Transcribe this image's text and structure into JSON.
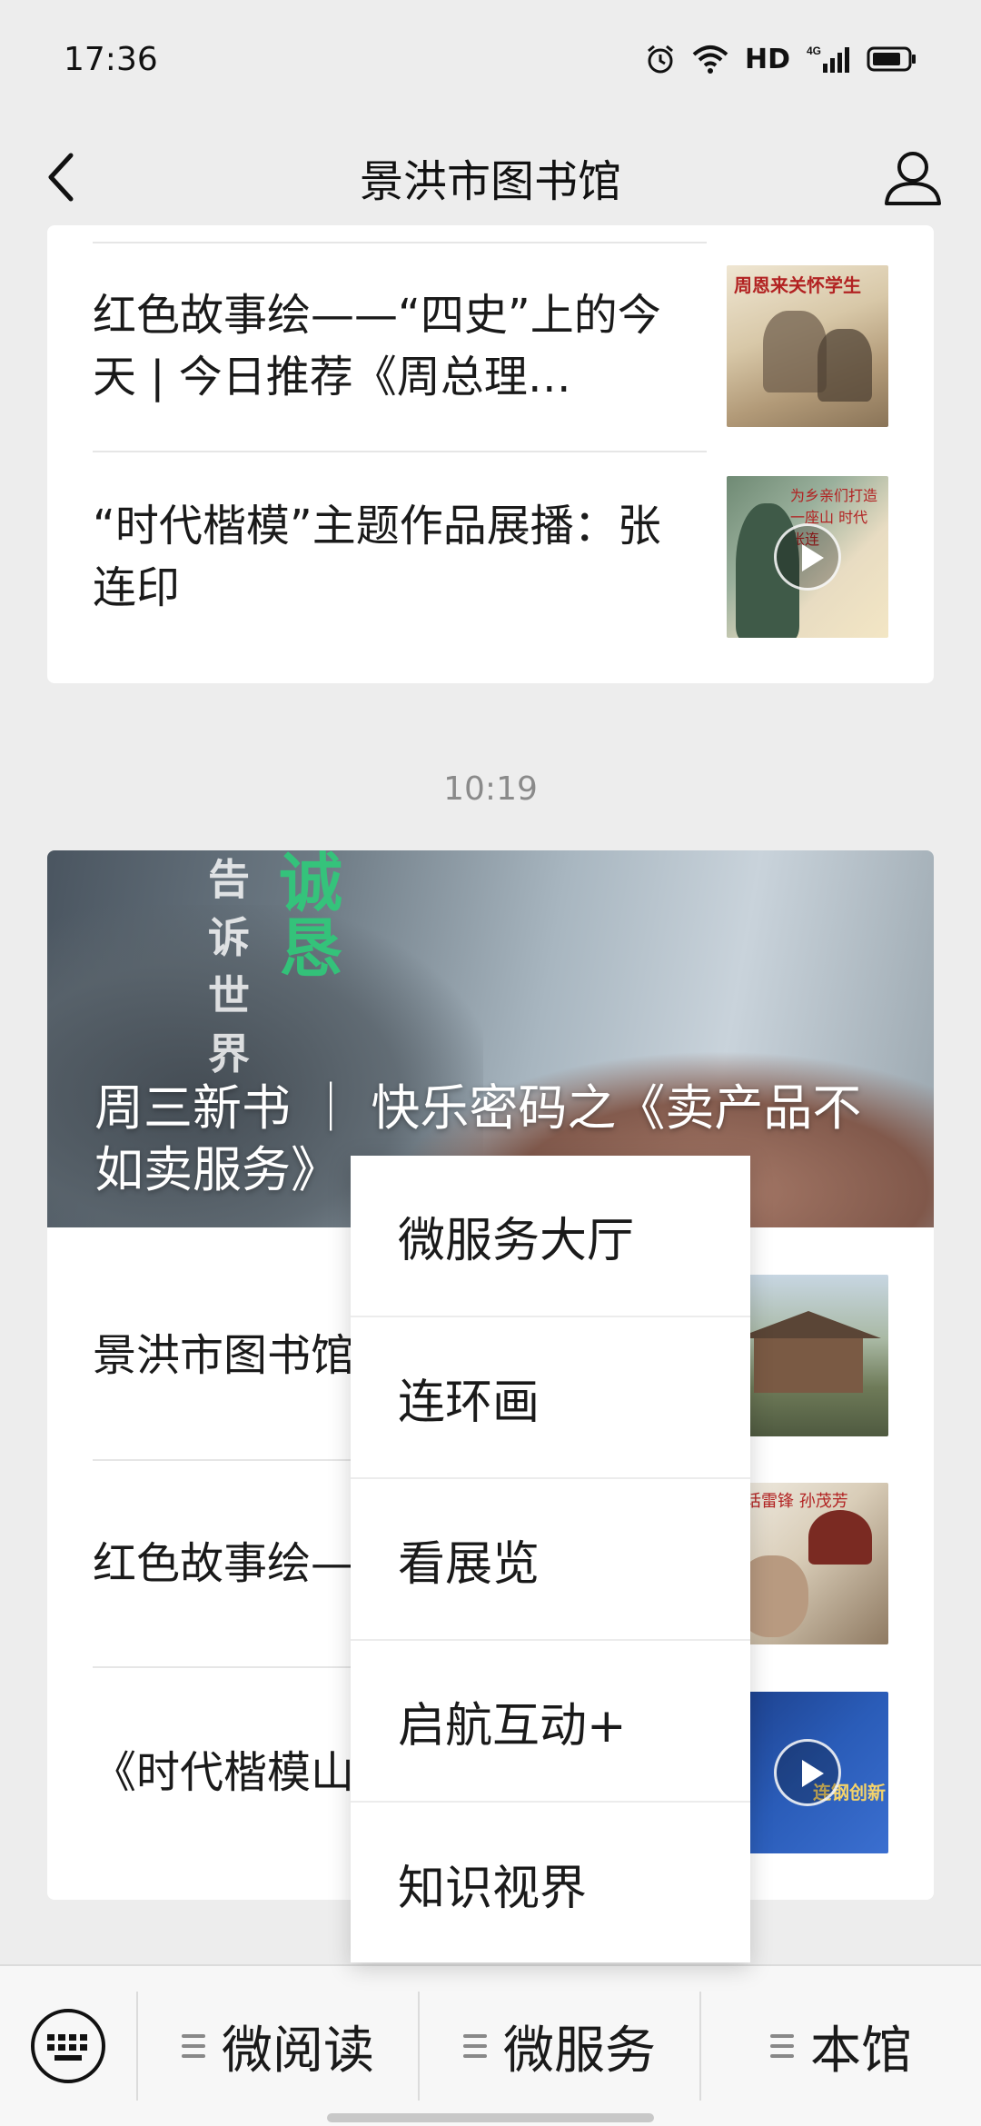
{
  "status_bar": {
    "time": "17:36",
    "network_label": "HD",
    "signal_label": "4G"
  },
  "nav": {
    "title": "景洪市图书馆"
  },
  "card_top": {
    "articles": [
      {
        "title": "红色故事绘——“四史”上的今天 | 今日推荐《周总理…",
        "thumb_caption": "周恩来关怀学生",
        "has_video": false
      },
      {
        "title": "“时代楷模”主题作品展播：张连印",
        "thumb_caption": "为乡亲们打造 一座山 时代 张连",
        "has_video": true
      }
    ]
  },
  "timestamp": "10:19",
  "card_main": {
    "hero_title": "周三新书 ｜ 快乐密码之《卖产品不如卖服务》",
    "hero_overlay_green": "诚恳",
    "hero_overlay_white": "告诉世界",
    "articles": [
      {
        "title": "景洪市图书馆 中国的“天下",
        "has_video": false
      },
      {
        "title": "红色故事绘—— 今天 | 今日推",
        "thumb_caption": "话雷锋 孙茂芳",
        "has_video": false
      },
      {
        "title": "《时代楷模山 港“连钢创新",
        "thumb_caption": "连钢创新",
        "has_video": true
      }
    ]
  },
  "popup_menu": {
    "items": [
      "微服务大厅",
      "连环画",
      "看展览",
      "启航互动+",
      "知识视界"
    ]
  },
  "bottom_menu": {
    "tabs": [
      "微阅读",
      "微服务",
      "本馆"
    ]
  },
  "colors": {
    "accent_green": "#2fcb7a",
    "background": "#ededed"
  }
}
